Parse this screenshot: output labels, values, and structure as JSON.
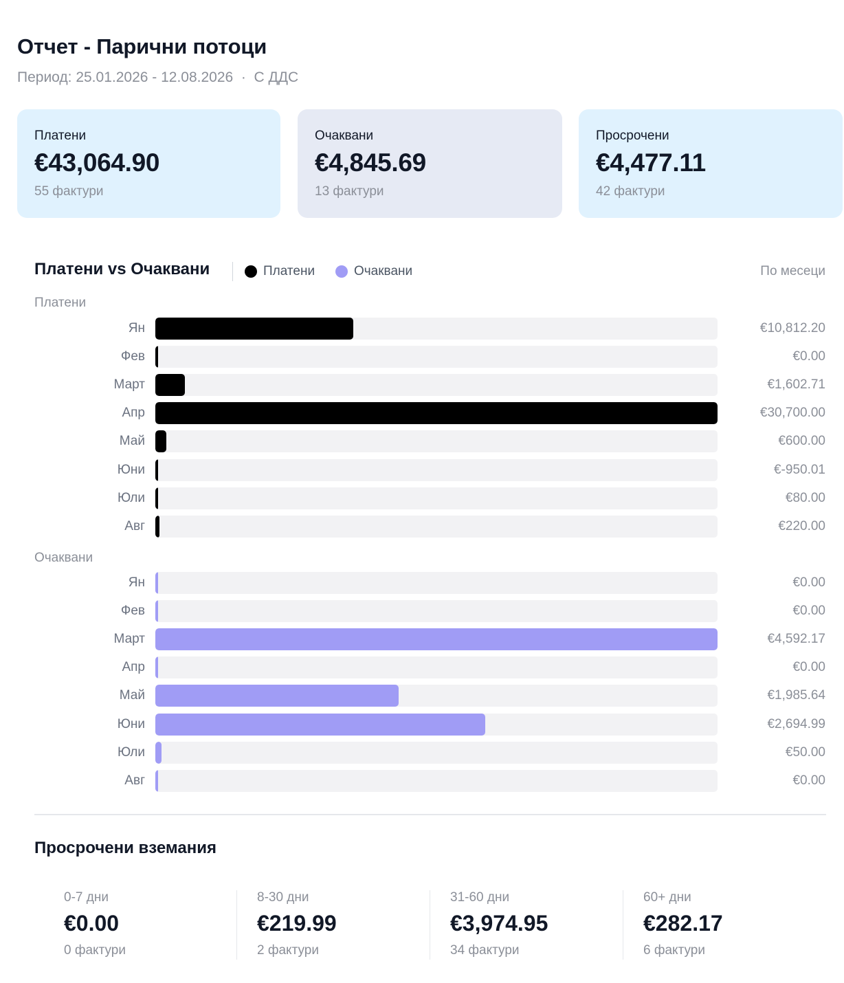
{
  "header": {
    "title": "Отчет - Парични потоци",
    "period": "Период: 25.01.2026 - 12.08.2026  ·  С ДДС"
  },
  "summary_cards": [
    {
      "label": "Платени",
      "amount": "€43,064.90",
      "count": "55 фактури",
      "bg": "#e0f2fe"
    },
    {
      "label": "Очаквани",
      "amount": "€4,845.69",
      "count": "13 фактури",
      "bg": "#e6eaf4"
    },
    {
      "label": "Просрочени",
      "amount": "€4,477.11",
      "count": "42 фактури",
      "bg": "#e0f2fe"
    }
  ],
  "chart_section": {
    "title": "Платени vs Очаквани",
    "legend": [
      {
        "label": "Платени",
        "color": "#000000"
      },
      {
        "label": "Очаквани",
        "color": "#a09cf5"
      }
    ],
    "period_select": "По месеци"
  },
  "chart_data": {
    "type": "bar",
    "orientation": "horizontal",
    "title": "Платени vs Очаквани",
    "categories": [
      "Ян",
      "Фев",
      "Март",
      "Апр",
      "Май",
      "Юни",
      "Юли",
      "Авг"
    ],
    "series": [
      {
        "name": "Платени",
        "color": "#000000",
        "values": [
          10812.2,
          0.0,
          1602.71,
          30700.0,
          600.0,
          -950.01,
          80.0,
          220.0
        ],
        "value_labels": [
          "€10,812.20",
          "€0.00",
          "€1,602.71",
          "€30,700.00",
          "€600.00",
          "€-950.01",
          "€80.00",
          "€220.00"
        ]
      },
      {
        "name": "Очаквани",
        "color": "#a09cf5",
        "values": [
          0.0,
          0.0,
          4592.17,
          0.0,
          1985.64,
          2694.99,
          50.0,
          0.0
        ],
        "value_labels": [
          "€0.00",
          "€0.00",
          "€4,592.17",
          "€0.00",
          "€1,985.64",
          "€2,694.99",
          "€50.00",
          "€0.00"
        ]
      }
    ],
    "scaling": "each series scaled to its own maximum",
    "track_color": "#f2f2f4"
  },
  "overdue": {
    "title": "Просрочени вземания",
    "buckets": [
      {
        "range": "0-7 дни",
        "amount": "€0.00",
        "count": "0 фактури"
      },
      {
        "range": "8-30 дни",
        "amount": "€219.99",
        "count": "2 фактури"
      },
      {
        "range": "31-60 дни",
        "amount": "€3,974.95",
        "count": "34 фактури"
      },
      {
        "range": "60+ дни",
        "amount": "€282.17",
        "count": "6 фактури"
      }
    ]
  }
}
